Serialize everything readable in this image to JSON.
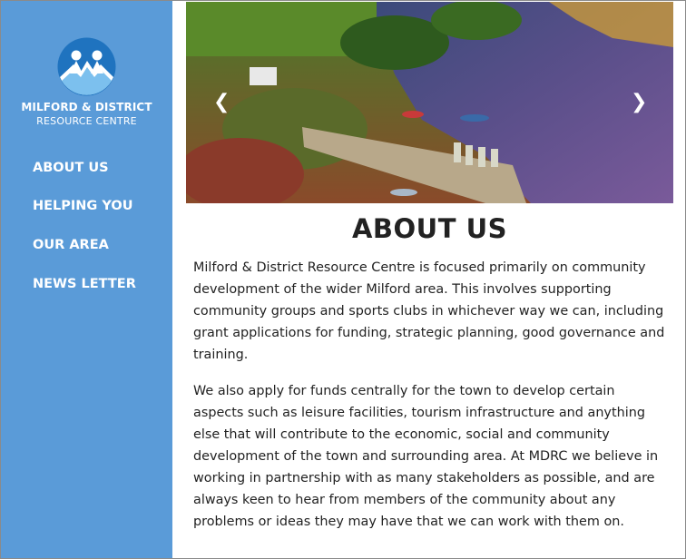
{
  "brand": {
    "name": "MILFORD & DISTRICT",
    "subtitle": "RESOURCE CENTRE",
    "logo_icon": "mountain-figures-logo"
  },
  "nav": {
    "items": [
      {
        "label": "ABOUT US"
      },
      {
        "label": "HELPING YOU"
      },
      {
        "label": "OUR AREA"
      },
      {
        "label": "NEWS LETTER"
      }
    ]
  },
  "carousel": {
    "image": "aerial-lake-photo",
    "prev_icon": "chevron-left-icon",
    "next_icon": "chevron-right-icon",
    "prev_glyph": "❮",
    "next_glyph": "❯"
  },
  "main": {
    "title": "ABOUT US",
    "paragraphs": [
      "Milford & District Resource Centre is focused primarily on community development of the wider Milford area. This involves supporting community groups and sports clubs in whichever way we can, including grant applications for funding, strategic planning, good governance and training.",
      "We also apply for funds centrally for the town to develop certain aspects such as leisure facilities, tourism infrastructure and anything else that will contribute to the economic, social and community development of the town and surrounding area. At MDRC we believe in working in partnership with as many stakeholders as possible, and are always keen to hear from members of the community about any problems or ideas they may have that we can work with them on."
    ]
  },
  "colors": {
    "sidebar": "#5a9bd8",
    "logo_circle": "#1f73bf",
    "text": "#222222"
  }
}
